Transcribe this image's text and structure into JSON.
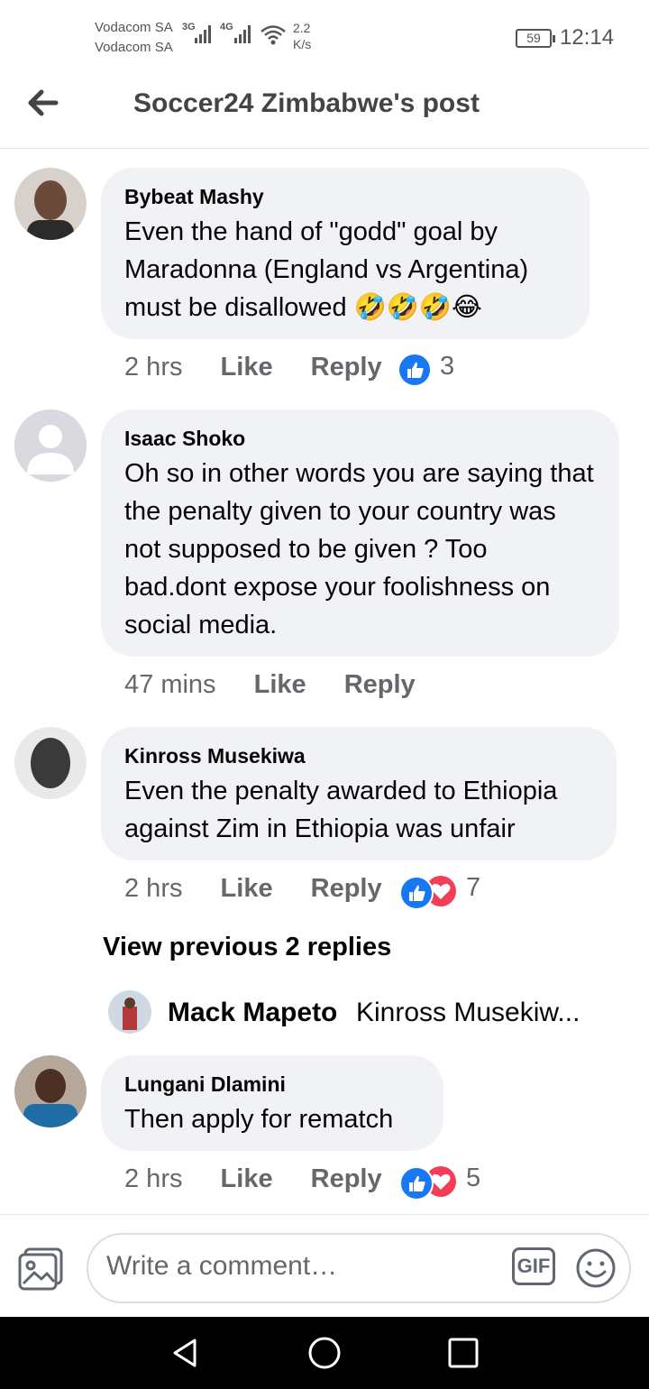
{
  "status": {
    "carrier1": "Vodacom SA",
    "carrier2": "Vodacom SA",
    "net1": "3G",
    "net2": "4G",
    "speed_value": "2.2",
    "speed_unit": "K/s",
    "battery": "59",
    "time": "12:14"
  },
  "header": {
    "title": "Soccer24 Zimbabwe's post",
    "back_icon": "arrow-left-icon"
  },
  "comments": [
    {
      "name": "Bybeat Mashy",
      "text": "Even the hand of \"godd\" goal by Maradonna (England vs Argentina) must be disallowed 🤣🤣🤣😂",
      "time": "2 hrs",
      "like": "Like",
      "reply": "Reply",
      "reactions": "3"
    },
    {
      "name": "Isaac Shoko",
      "text": "Oh so in other words you are saying that the penalty given to your country was not supposed to be given ? Too bad.dont expose your foolishness on social media.",
      "time": "47 mins",
      "like": "Like",
      "reply": "Reply",
      "reactions": ""
    },
    {
      "name": "Kinross Musekiwa",
      "text": "Even the penalty awarded to Ethiopia against Zim in Ethiopia was unfair",
      "time": "2 hrs",
      "like": "Like",
      "reply": "Reply",
      "reactions": "7"
    },
    {
      "name": "Lungani Dlamini",
      "text": "Then apply for rematch",
      "time": "2 hrs",
      "like": "Like",
      "reply": "Reply",
      "reactions": "5"
    }
  ],
  "view_previous": "View previous 2 replies",
  "latest_reply": {
    "name": "Mack Mapeto",
    "snippet": "Kinross Musekiw..."
  },
  "composer": {
    "placeholder": "Write a comment…",
    "gif_label": "GIF"
  },
  "colors": {
    "like_blue": "#1877f2",
    "love_red": "#f33e58",
    "bubble": "#f0f2f5",
    "meta": "#65676b"
  }
}
